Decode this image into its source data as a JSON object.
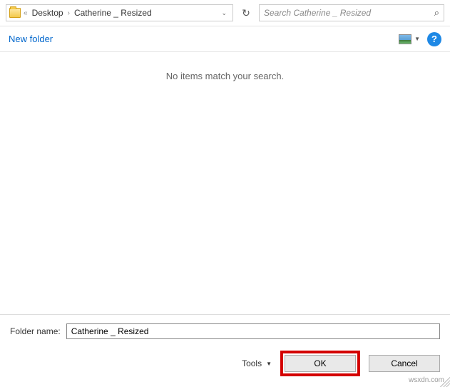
{
  "breadcrumb": {
    "overflow": "«",
    "parent": "Desktop",
    "separator": "›",
    "current": "Catherine _ Resized"
  },
  "search": {
    "placeholder": "Search Catherine _ Resized"
  },
  "toolbar": {
    "new_folder": "New folder"
  },
  "content": {
    "empty_message": "No items match your search."
  },
  "footer": {
    "folder_name_label": "Folder name:",
    "folder_name_value": "Catherine _ Resized",
    "tools_label": "Tools",
    "ok_label": "OK",
    "cancel_label": "Cancel"
  },
  "watermark": "wsxdn.com"
}
